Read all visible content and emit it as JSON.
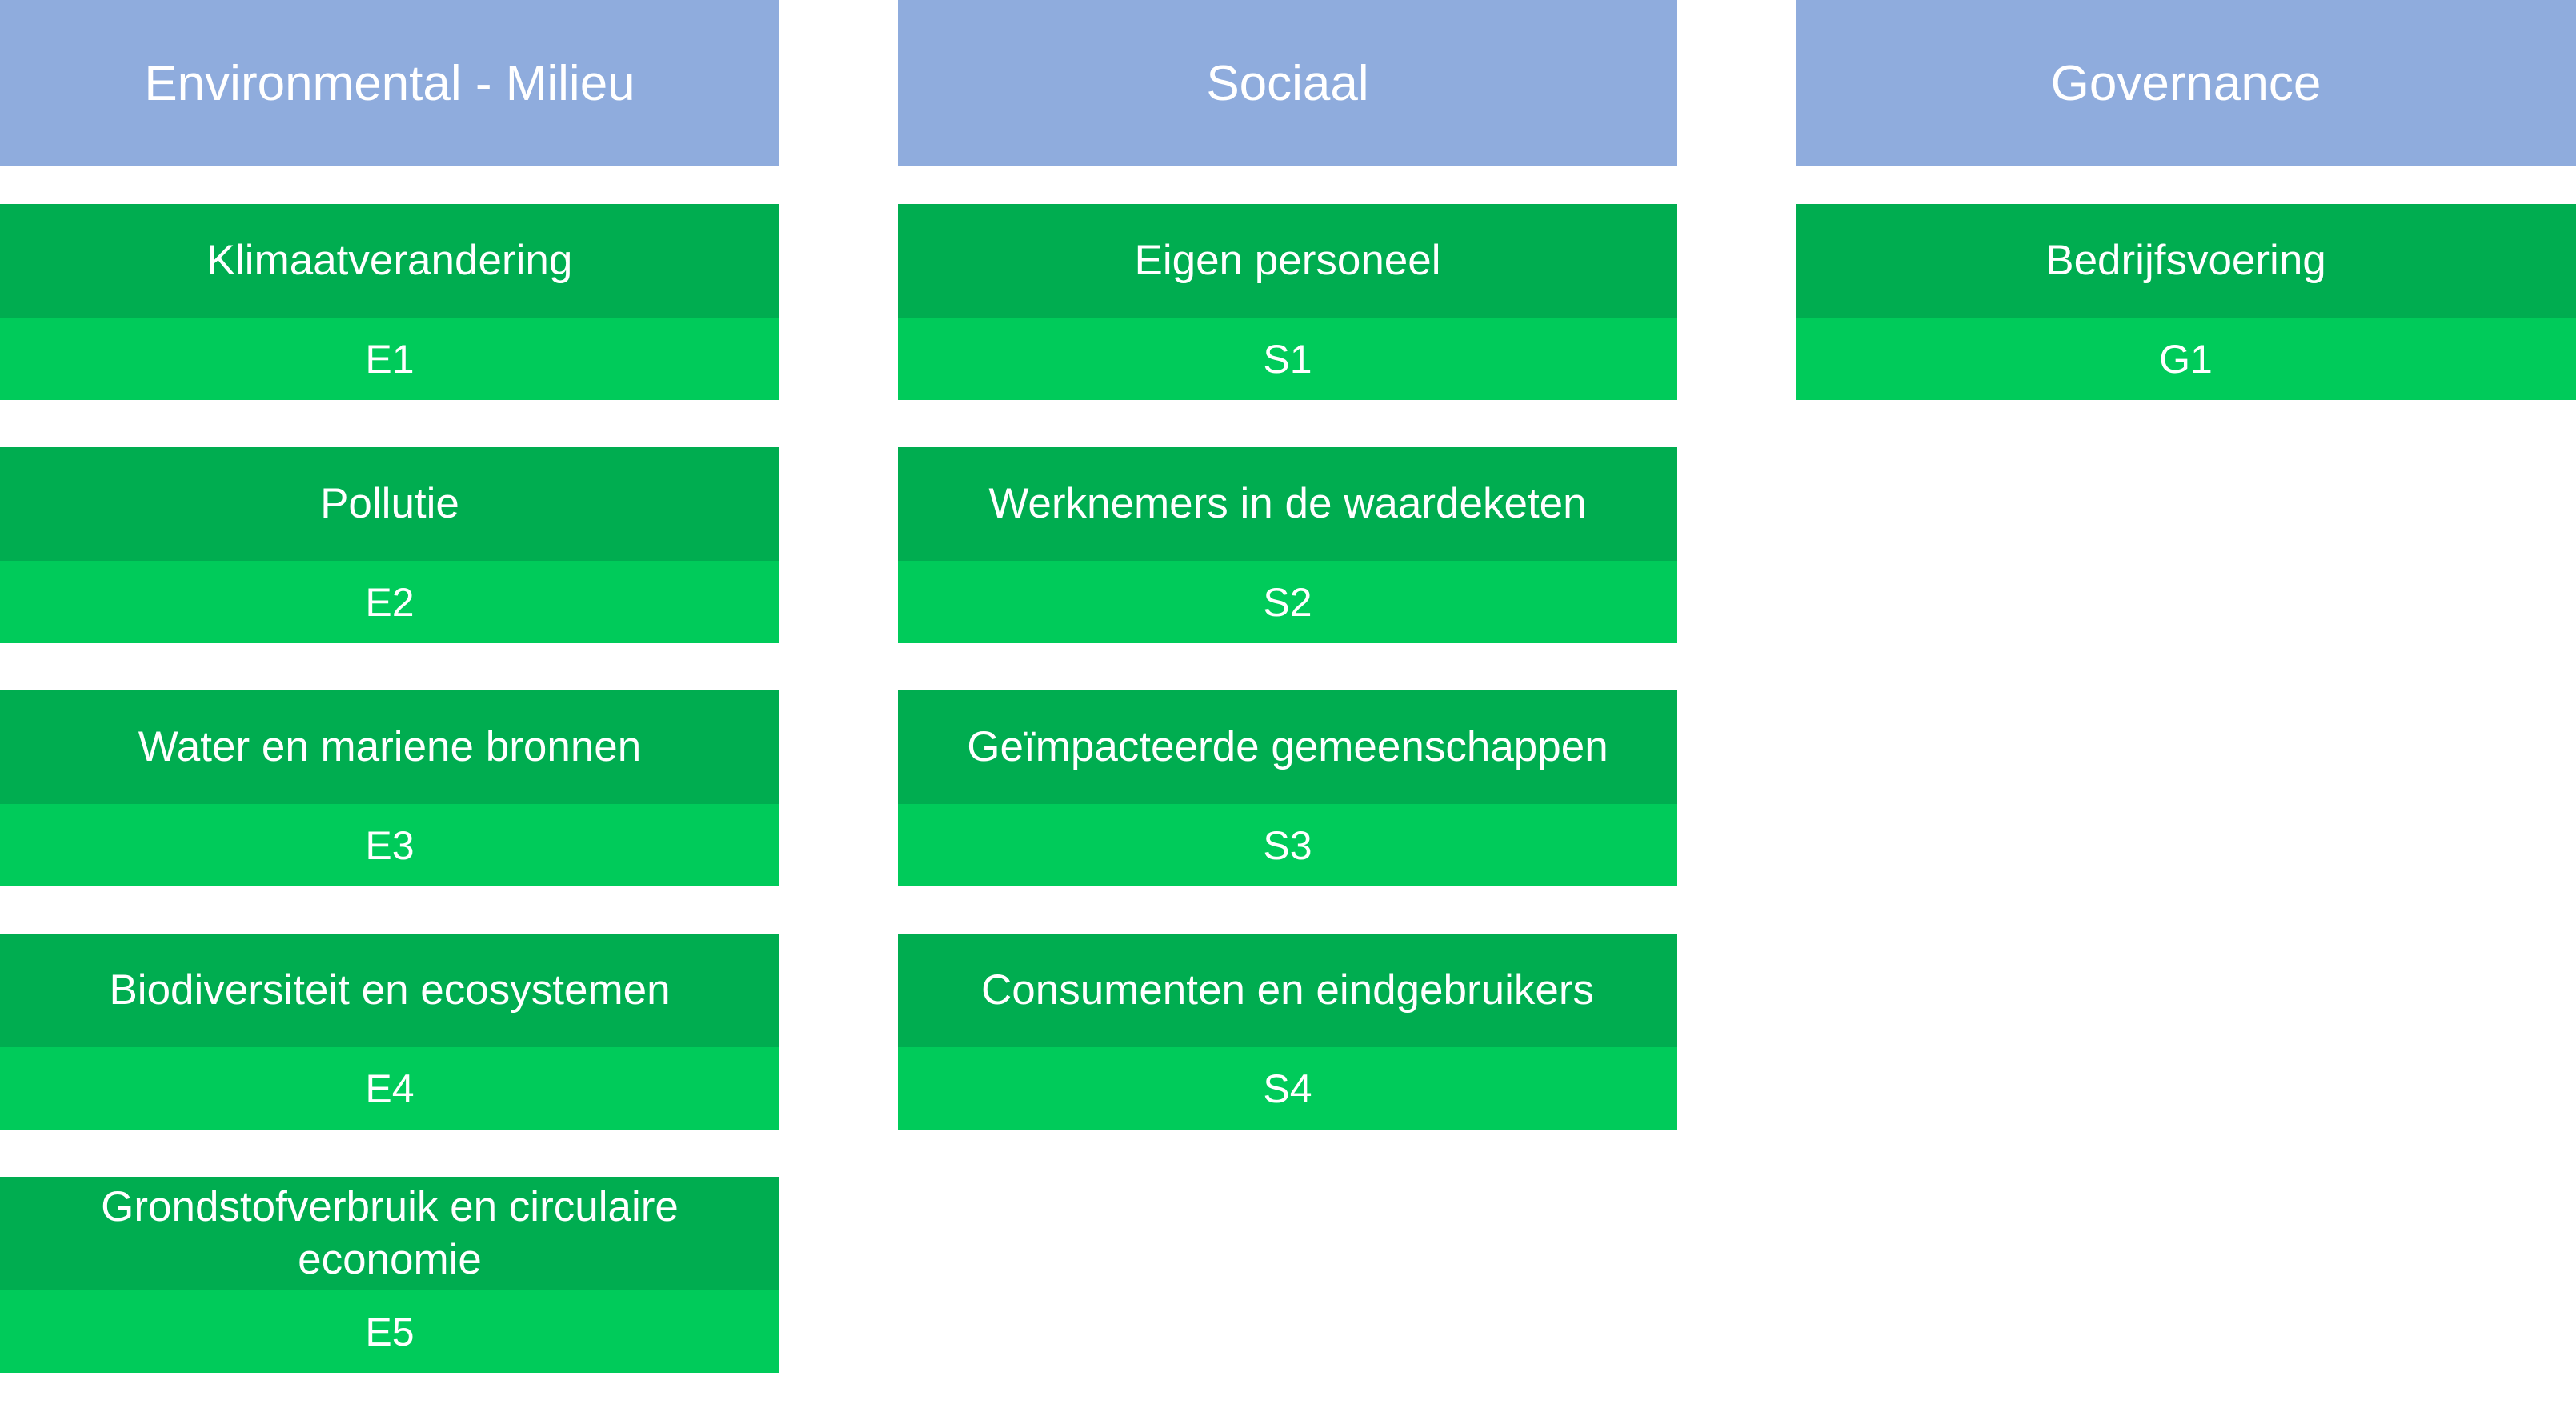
{
  "colors": {
    "header": "#8FACDD",
    "topic_dark": "#00AD50",
    "code_light": "#00CB5A",
    "text": "#FFFFFF"
  },
  "columns": [
    {
      "title": "Environmental - Milieu",
      "topics": [
        {
          "name": "Klimaatverandering",
          "code": "E1"
        },
        {
          "name": "Pollutie",
          "code": "E2"
        },
        {
          "name": "Water en mariene bronnen",
          "code": "E3"
        },
        {
          "name": "Biodiversiteit en ecosystemen",
          "code": "E4"
        },
        {
          "name": "Grondstofverbruik en circulaire economie",
          "code": "E5"
        }
      ]
    },
    {
      "title": "Sociaal",
      "topics": [
        {
          "name": "Eigen personeel",
          "code": "S1"
        },
        {
          "name": "Werknemers in de waardeketen",
          "code": "S2"
        },
        {
          "name": "Geïmpacteerde gemeenschappen",
          "code": "S3"
        },
        {
          "name": "Consumenten en eindgebruikers",
          "code": "S4"
        }
      ]
    },
    {
      "title": "Governance",
      "topics": [
        {
          "name": "Bedrijfsvoering",
          "code": "G1"
        }
      ]
    }
  ]
}
